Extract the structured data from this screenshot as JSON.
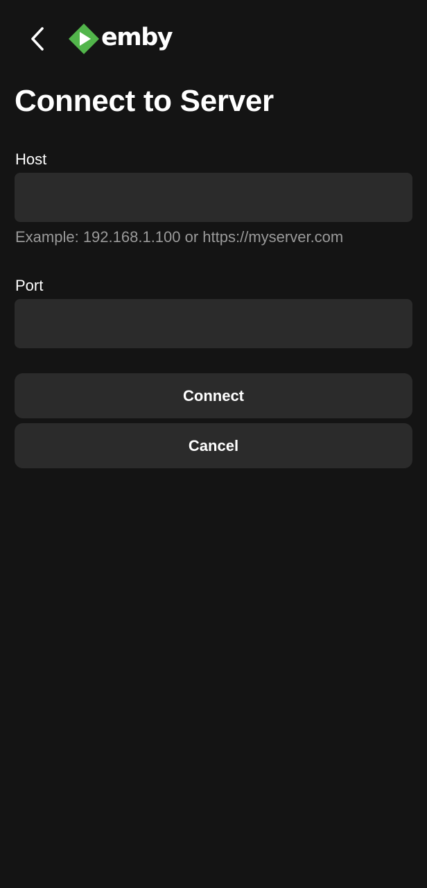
{
  "header": {
    "back_icon": "chevron-left-icon",
    "logo_text": "emby",
    "logo_icon": "emby-play-diamond-icon",
    "brand_color": "#52b54b"
  },
  "page": {
    "title": "Connect to Server"
  },
  "form": {
    "host": {
      "label": "Host",
      "value": "",
      "hint": "Example: 192.168.1.100 or https://myserver.com"
    },
    "port": {
      "label": "Port",
      "value": ""
    }
  },
  "actions": {
    "connect_label": "Connect",
    "cancel_label": "Cancel"
  },
  "colors": {
    "background": "#141414",
    "surface": "#2b2b2b",
    "text": "#ffffff",
    "hint_text": "#9a9a9a"
  }
}
